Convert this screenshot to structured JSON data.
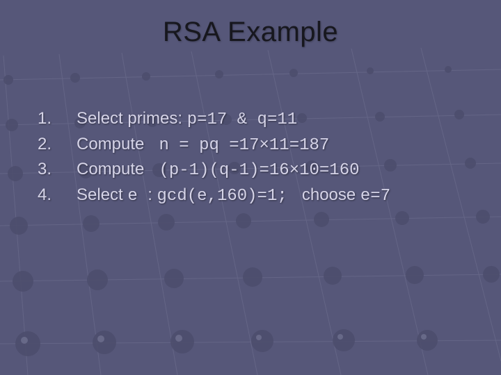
{
  "title": "RSA Example",
  "items": [
    {
      "num": "1.",
      "prefix": "Select primes: ",
      "code1": "p=17 & q=11",
      "mid": "",
      "code2": "",
      "suffix": ""
    },
    {
      "num": "2.",
      "prefix": "Compute ",
      "code1": " n = pq ",
      "mid": "",
      "code2": "=17×11=187",
      "suffix": ""
    },
    {
      "num": "3.",
      "prefix": "Compute ",
      "code1": " (p-1)(q-1)=16×10=160",
      "mid": "",
      "code2": "",
      "suffix": ""
    },
    {
      "num": "4.",
      "prefix": "Select ",
      "code1": "e ",
      "mid": ": ",
      "code2": "gcd(e,160)=1; ",
      "suffix": " choose ",
      "code3": "e=7"
    }
  ]
}
